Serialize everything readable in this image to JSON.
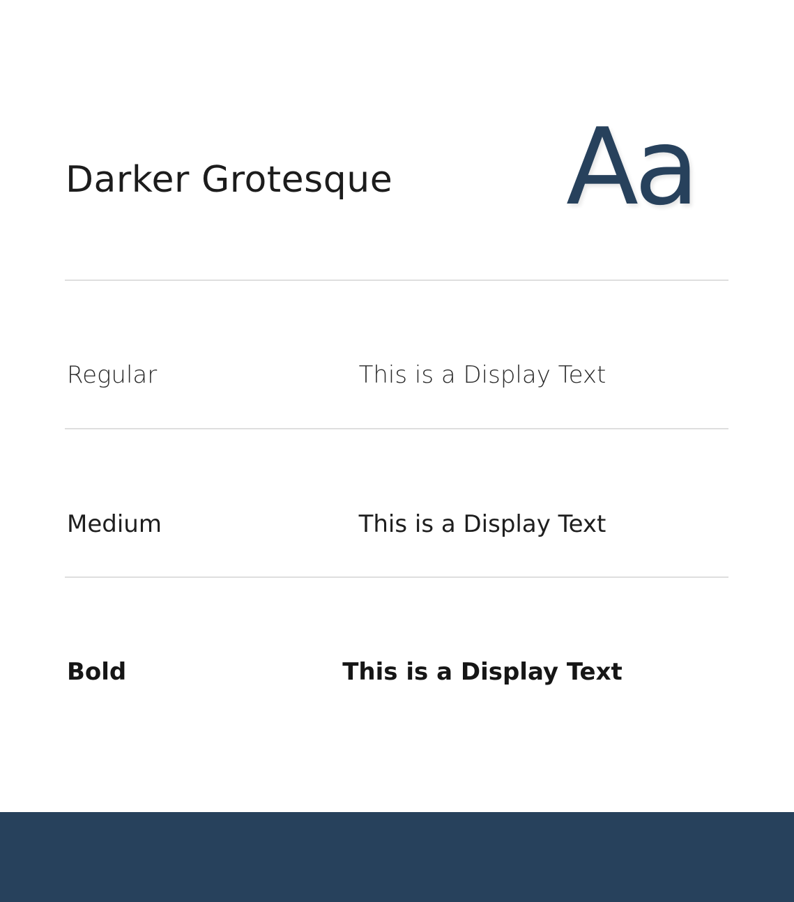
{
  "font": {
    "name": "Darker Grotesque",
    "specimen": "Aa",
    "specimen_color": "#27415c"
  },
  "weights": [
    {
      "label": "Regular",
      "sample": "This is a Display Text"
    },
    {
      "label": "Medium",
      "sample": "This is a Display Text"
    },
    {
      "label": "Bold",
      "sample": "This is a Display Text"
    }
  ],
  "colors": {
    "accent": "#27415c",
    "text": "#1c1c1c",
    "divider": "#dedede",
    "background": "#ffffff"
  }
}
